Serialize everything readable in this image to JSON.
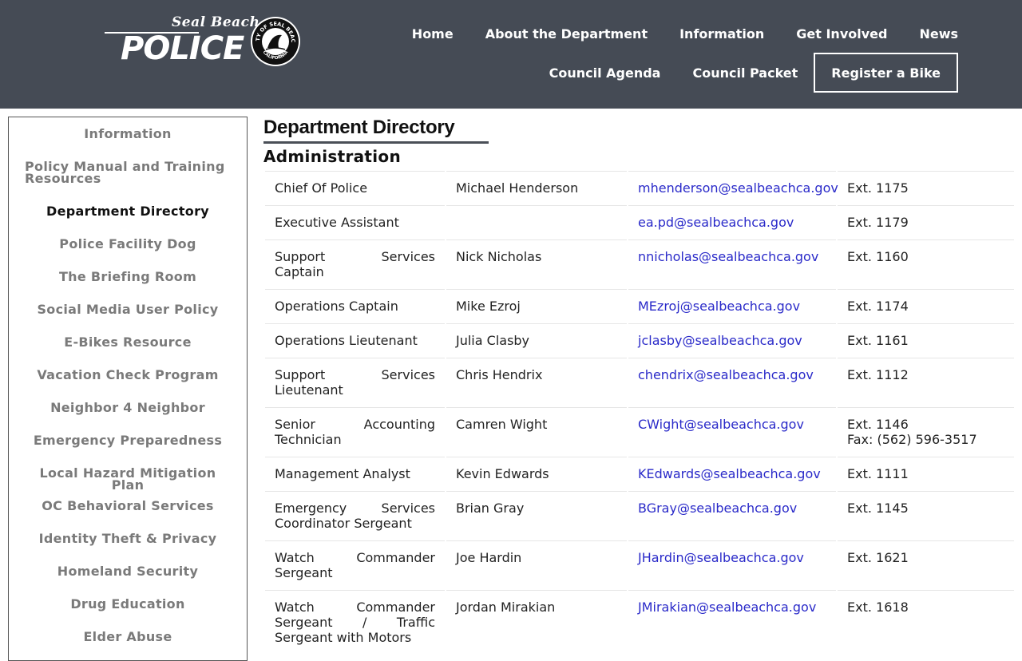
{
  "header": {
    "logo_script": "Seal Beach",
    "logo_main": "POLICE",
    "seal_top_text": "CITY OF SEAL BEACH",
    "seal_bottom_text": "CALIFORNIA",
    "nav_row1": [
      "Home",
      "About the Department",
      "Information",
      "Get Involved",
      "News"
    ],
    "nav_row2": [
      "Council Agenda",
      "Council Packet"
    ],
    "register_label": "Register a Bike"
  },
  "sidebar": {
    "items": [
      {
        "label": "Information"
      },
      {
        "label": "Policy Manual and Training Resources"
      },
      {
        "label": "Department Directory",
        "active": true
      },
      {
        "label": "Police Facility Dog"
      },
      {
        "label": "The Briefing Room"
      },
      {
        "label": "Social Media User Policy"
      },
      {
        "label": "E-Bikes Resource"
      },
      {
        "label": "Vacation Check Program"
      },
      {
        "label": "Neighbor 4 Neighbor"
      },
      {
        "label": "Emergency Preparedness"
      },
      {
        "label": "Local Hazard Mitigation Plan"
      },
      {
        "label": "OC Behavioral Services"
      },
      {
        "label": "Identity Theft & Privacy"
      },
      {
        "label": "Homeland Security"
      },
      {
        "label": "Drug Education"
      },
      {
        "label": "Elder Abuse"
      }
    ]
  },
  "main": {
    "page_title": "Department Directory",
    "section_title": "Administration",
    "rows": [
      {
        "title": "Chief Of Police",
        "name": "Michael Henderson",
        "email": "mhenderson@sealbeachca.gov",
        "ext": "Ext. 1175",
        "fax": ""
      },
      {
        "title": "Executive Assistant",
        "name": "",
        "email": "ea.pd@sealbeachca.gov",
        "ext": "Ext. 1179",
        "fax": ""
      },
      {
        "title": "Support Services Captain",
        "name": "Nick Nicholas",
        "email": "nnicholas@sealbeachca.gov",
        "ext": "Ext. 1160",
        "fax": ""
      },
      {
        "title": "Operations Captain",
        "name": "Mike Ezroj",
        "email": "MEzroj@sealbeachca.gov",
        "ext": "Ext. 1174",
        "fax": ""
      },
      {
        "title": "Operations Lieutenant",
        "name": "Julia Clasby",
        "email": "jclasby@sealbeachca.gov",
        "ext": "Ext. 1161",
        "fax": ""
      },
      {
        "title": "Support Services Lieutenant",
        "name": "Chris Hendrix",
        "email": "chendrix@sealbeachca.gov",
        "ext": "Ext. 1112",
        "fax": ""
      },
      {
        "title": "Senior Accounting Technician",
        "name": "Camren Wight",
        "email": "CWight@sealbeachca.gov",
        "ext": "Ext. 1146",
        "fax": "Fax: (562) 596-3517"
      },
      {
        "title": "Management Analyst",
        "name": "Kevin Edwards",
        "email": "KEdwards@sealbeachca.gov",
        "ext": "Ext. 1111",
        "fax": ""
      },
      {
        "title": "Emergency Services Coordinator Sergeant",
        "name": "Brian Gray",
        "email": "BGray@sealbeachca.gov",
        "ext": "Ext. 1145",
        "fax": ""
      },
      {
        "title": "Watch Commander Sergeant",
        "name": "Joe Hardin",
        "email": "JHardin@sealbeachca.gov",
        "ext": "Ext. 1621",
        "fax": ""
      },
      {
        "title": "Watch Commander Sergeant / Traffic Sergeant with Motors",
        "name": "Jordan Mirakian",
        "email": "JMirakian@sealbeachca.gov",
        "ext": "Ext. 1618",
        "fax": ""
      }
    ]
  },
  "colors": {
    "header_bg": "#454b55",
    "link_blue": "#2a2ac9",
    "sidebar_text": "#7a7a7a"
  }
}
